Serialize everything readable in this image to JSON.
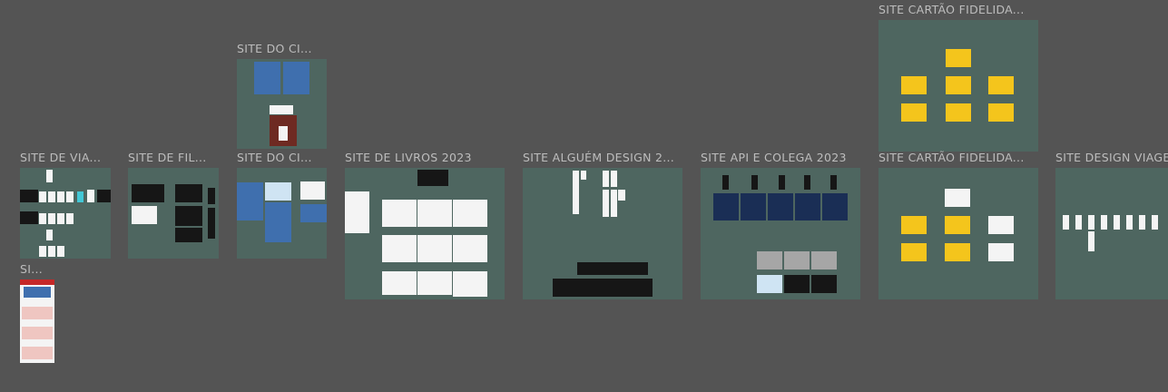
{
  "boards": [
    {
      "id": "viagens",
      "label": "SITE DE VIA..."
    },
    {
      "id": "filmes",
      "label": "SITE DE FIL..."
    },
    {
      "id": "cinema-top",
      "label": "SITE DO CI..."
    },
    {
      "id": "cinema",
      "label": "SITE DO CI..."
    },
    {
      "id": "livros",
      "label": "SITE DE LIVROS 2023"
    },
    {
      "id": "alguem",
      "label": "SITE ALGUÉM DESIGN 2..."
    },
    {
      "id": "api",
      "label": "SITE API E COLEGA 2023"
    },
    {
      "id": "cartao-top",
      "label": "SITE CARTÃO FIDELIDA..."
    },
    {
      "id": "cartao",
      "label": "SITE CARTÃO FIDELIDA..."
    },
    {
      "id": "design-viagem",
      "label": "SITE DESIGN VIAGEM"
    },
    {
      "id": "si",
      "label": "SI..."
    }
  ],
  "colors": {
    "background": "#545454",
    "board": "#4e6660",
    "label": "#bdbdbd"
  }
}
